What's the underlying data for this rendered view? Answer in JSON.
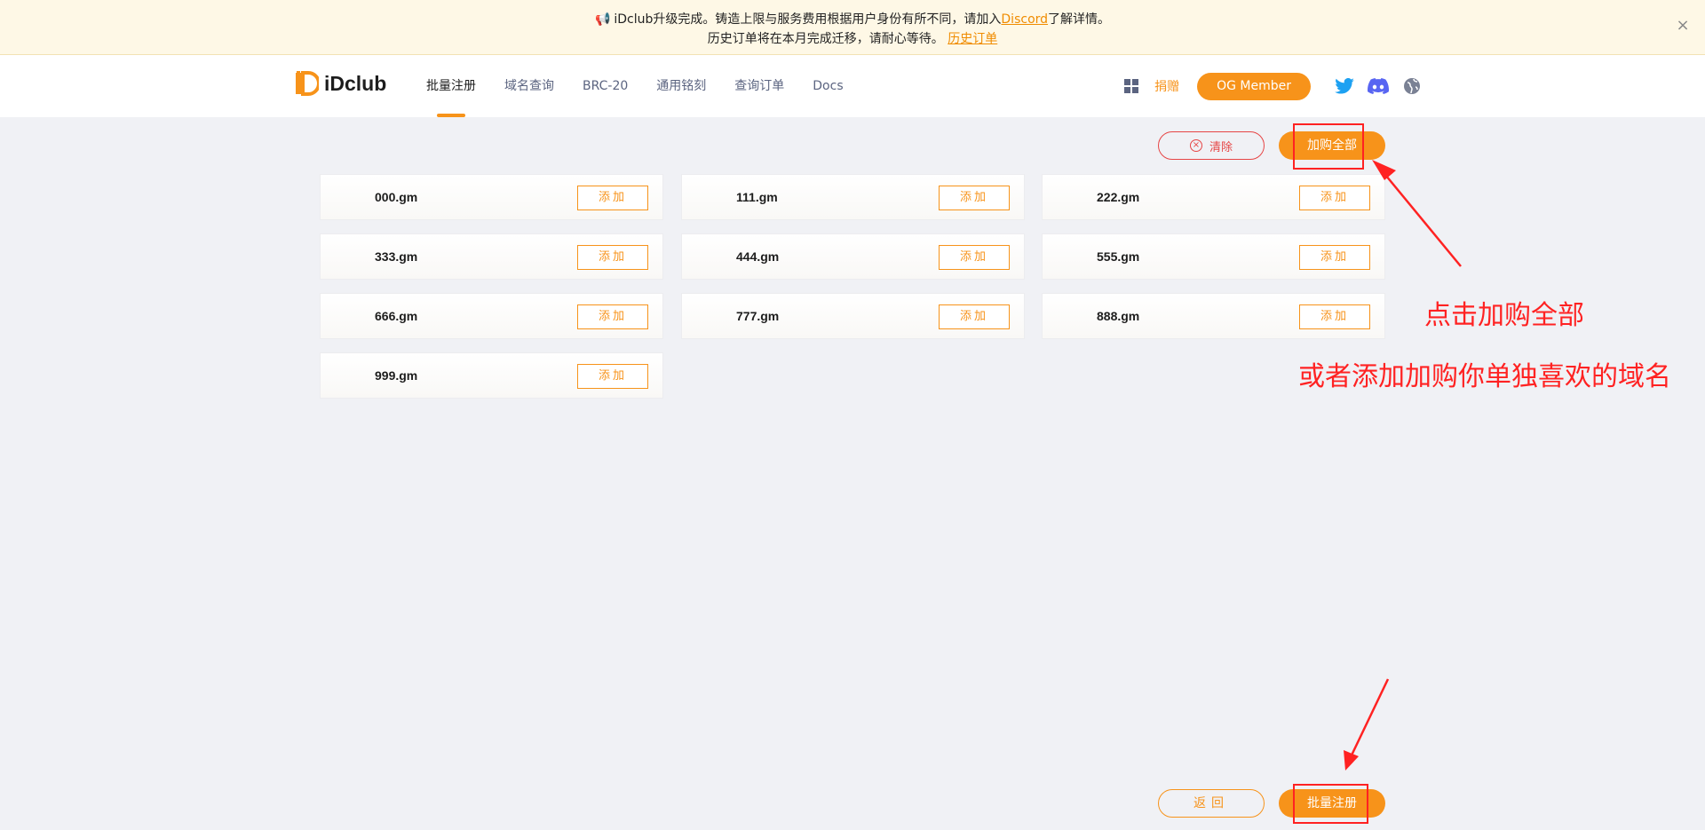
{
  "banner": {
    "line1_prefix": "iDclub升级完成。铸造上限与服务费用根据用户身份有所不同，请加入",
    "discord_link": "Discord",
    "line1_suffix": "了解详情。",
    "line2_prefix": "历史订单将在本月完成迁移，请耐心等待。",
    "history_link": "历史订单",
    "close": "×"
  },
  "header": {
    "logo_text": "iDclub",
    "nav": [
      {
        "label": "批量注册",
        "active": true
      },
      {
        "label": "域名查询"
      },
      {
        "label": "BRC-20"
      },
      {
        "label": "通用铭刻"
      },
      {
        "label": "查询订单"
      },
      {
        "label": "Docs"
      }
    ],
    "donate": "捐赠",
    "og_member": "OG Member"
  },
  "actions": {
    "clear": "清除",
    "add_all": "加购全部",
    "back": "返回",
    "bulk_register": "批量注册"
  },
  "domains": [
    {
      "name": "000.gm",
      "add": "添加"
    },
    {
      "name": "111.gm",
      "add": "添加"
    },
    {
      "name": "222.gm",
      "add": "添加"
    },
    {
      "name": "333.gm",
      "add": "添加"
    },
    {
      "name": "444.gm",
      "add": "添加"
    },
    {
      "name": "555.gm",
      "add": "添加"
    },
    {
      "name": "666.gm",
      "add": "添加"
    },
    {
      "name": "777.gm",
      "add": "添加"
    },
    {
      "name": "888.gm",
      "add": "添加"
    },
    {
      "name": "999.gm",
      "add": "添加"
    }
  ],
  "annotations": {
    "text1": "点击加购全部",
    "text2": "或者添加加购你单独喜欢的域名"
  },
  "colors": {
    "accent": "#f7931a",
    "danger": "#e64545",
    "annotation": "#ff2222"
  }
}
